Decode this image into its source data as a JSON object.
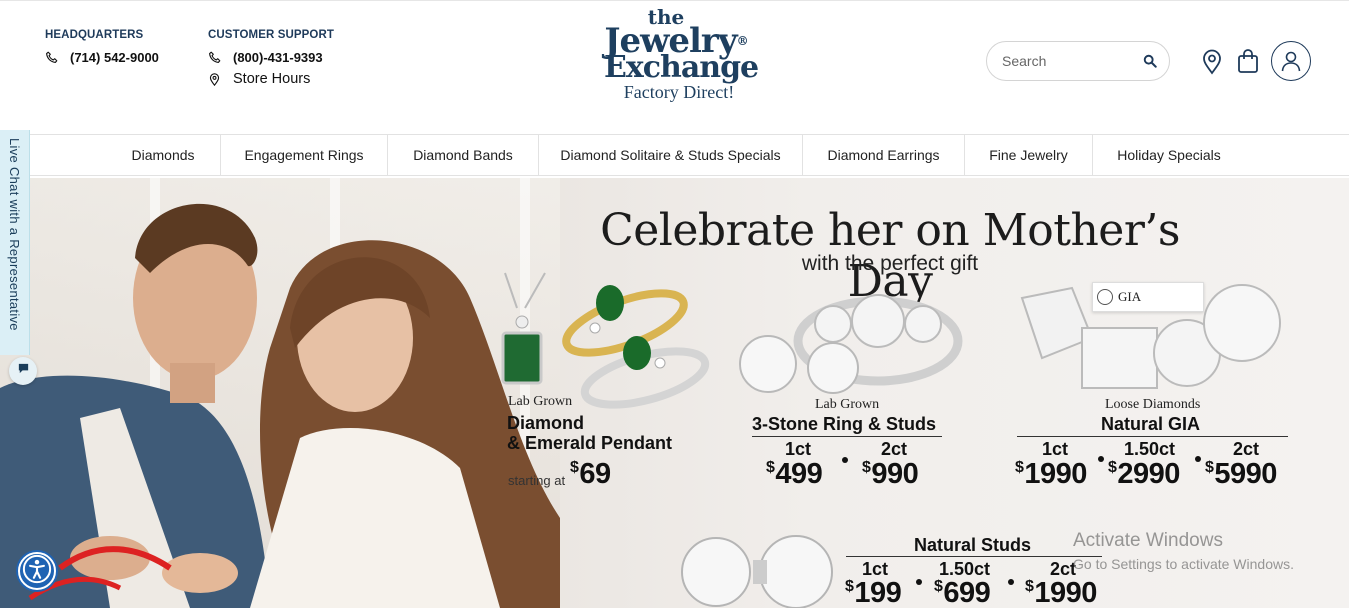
{
  "header": {
    "headquarters": {
      "heading": "HEADQUARTERS",
      "phone": "(714) 542-9000"
    },
    "customer_support": {
      "heading": "CUSTOMER SUPPORT",
      "phone": "(800)-431-9393",
      "store_hours": "Store Hours"
    },
    "logo": {
      "line1": "the",
      "line2": "Jewelry",
      "line3": "Exchange",
      "line4": "Factory Direct!",
      "registered": "®"
    },
    "search": {
      "placeholder": "Search"
    },
    "icons": [
      "phone-icon",
      "map-pin-icon",
      "search-icon",
      "location-icon",
      "shopping-bag-icon",
      "user-account-icon"
    ]
  },
  "nav": {
    "items": [
      {
        "label": "Diamonds"
      },
      {
        "label": "Engagement Rings"
      },
      {
        "label": "Diamond Bands"
      },
      {
        "label": "Diamond Solitaire & Studs Specials"
      },
      {
        "label": "Diamond Earrings"
      },
      {
        "label": "Fine Jewelry"
      },
      {
        "label": "Holiday Specials"
      }
    ]
  },
  "hero": {
    "headline": "Celebrate her on Mother’s Day",
    "subhead": "with the perfect gift",
    "products": {
      "pendant": {
        "label": "Lab Grown",
        "name1": "Diamond",
        "name2": "& Emerald Pendant",
        "starting": "starting at",
        "currency": "$",
        "price": "69"
      },
      "three_stone": {
        "label": "Lab Grown",
        "name": "3-Stone Ring & Studs",
        "sizes": [
          "1ct",
          "2ct"
        ],
        "currency": "$",
        "prices": [
          "499",
          "990"
        ]
      },
      "gia": {
        "label": "Loose Diamonds",
        "name": "Natural GIA",
        "tag": "GIA",
        "sizes": [
          "1ct",
          "1.50ct",
          "2ct"
        ],
        "currency": "$",
        "prices": [
          "1990",
          "2990",
          "5990"
        ]
      },
      "studs": {
        "name": "Natural Studs",
        "sizes": [
          "1ct",
          "1.50ct",
          "2ct"
        ],
        "currency": "$",
        "prices": [
          "199",
          "699",
          "1990"
        ]
      }
    }
  },
  "overlays": {
    "live_chat_label": "Live Chat with a Representative",
    "watermark_title": "Activate Windows",
    "watermark_sub": "Go to Settings to activate Windows."
  },
  "colors": {
    "brand_navy": "#1e3f5f",
    "accessibility_blue": "#1f63b3",
    "live_chat_bg": "#dbeff6"
  }
}
